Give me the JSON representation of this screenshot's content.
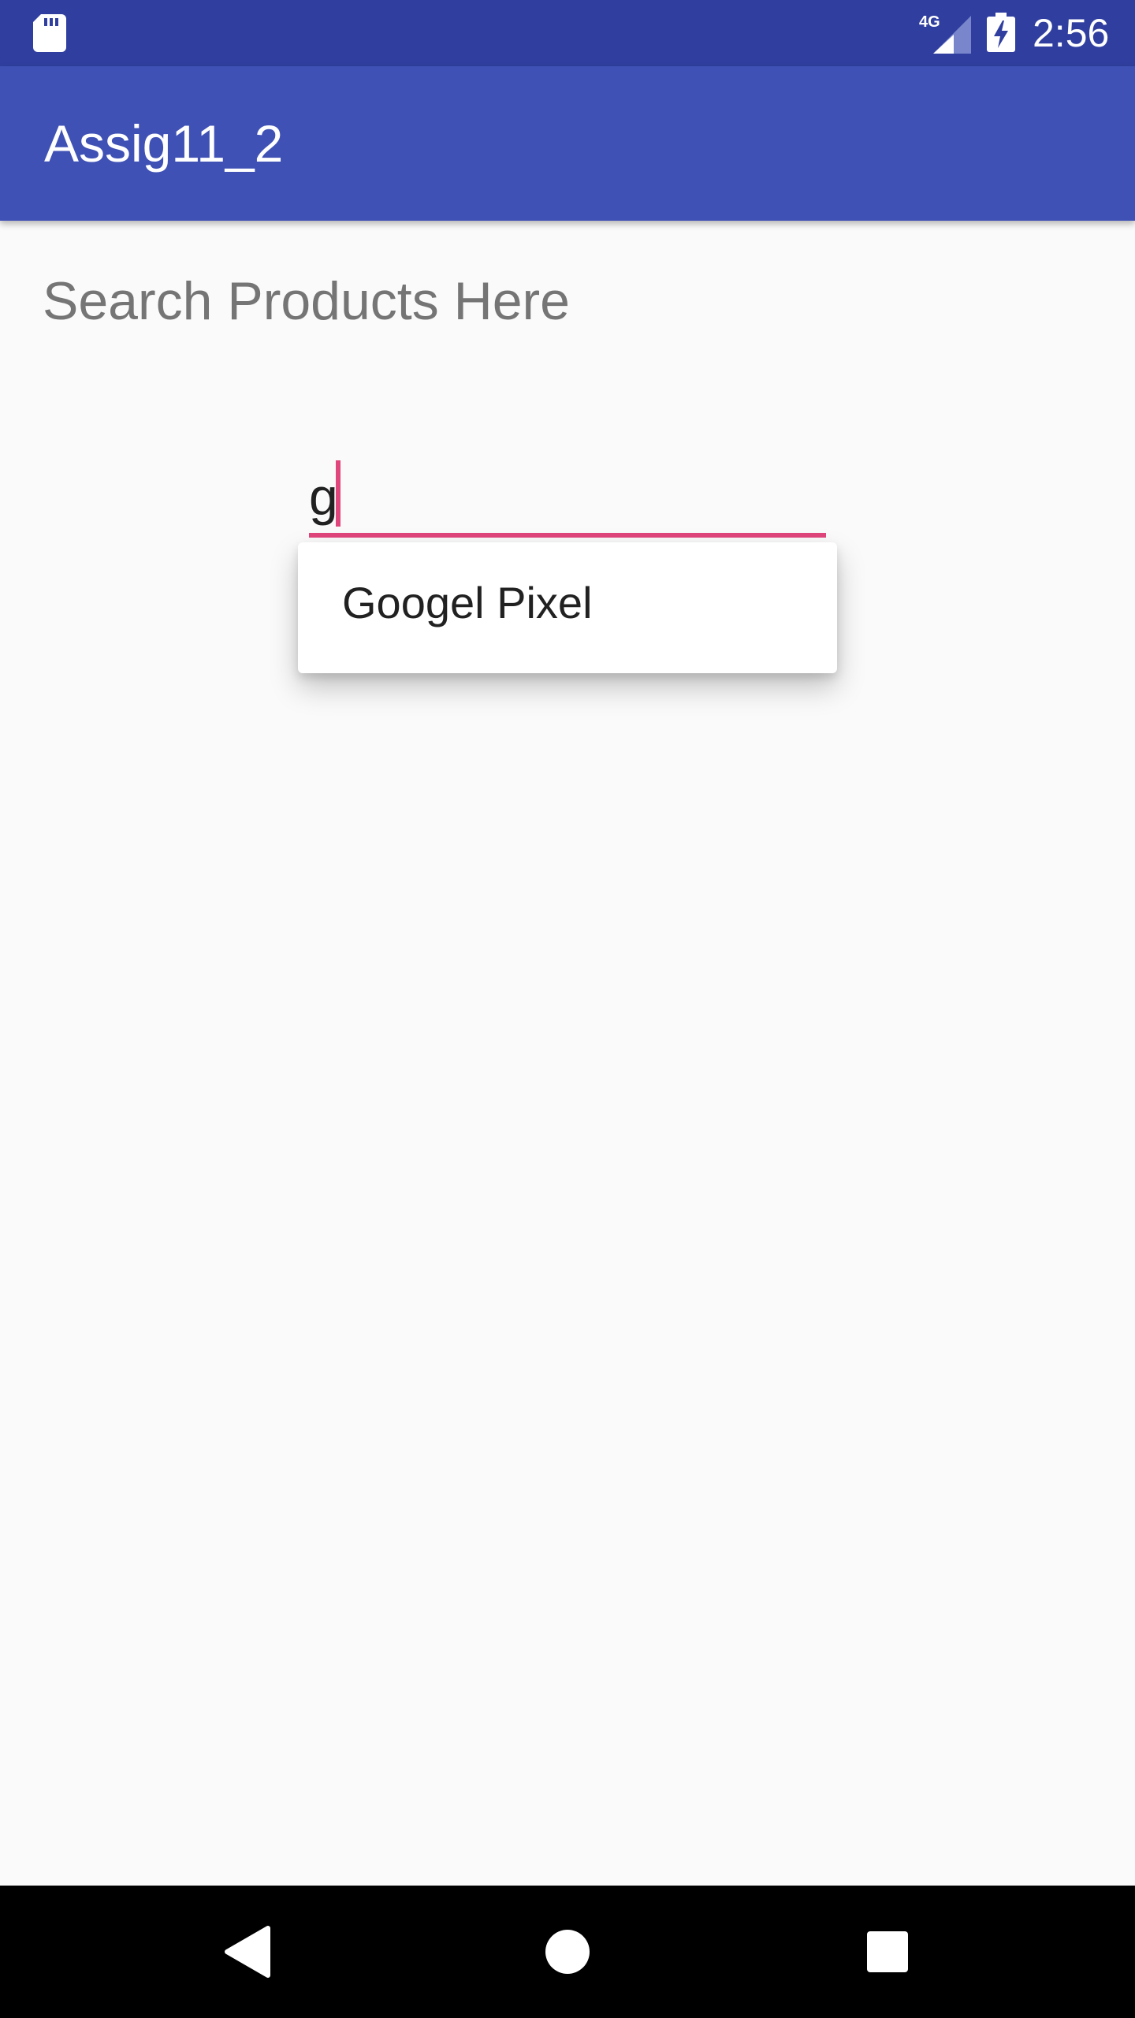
{
  "status_bar": {
    "time": "2:56",
    "network": "4G",
    "icons": [
      "sd-card-icon",
      "signal-4g-icon",
      "battery-charging-icon"
    ]
  },
  "app_bar": {
    "title": "Assig11_2",
    "color": "#3f51b5"
  },
  "main": {
    "heading": "Search Products Here",
    "search": {
      "value": "g",
      "accent_color": "#e0457b"
    },
    "suggestions": [
      {
        "label": "Googel Pixel"
      }
    ]
  },
  "nav_bar": {
    "icons": [
      "back-icon",
      "home-icon",
      "recents-icon"
    ]
  }
}
